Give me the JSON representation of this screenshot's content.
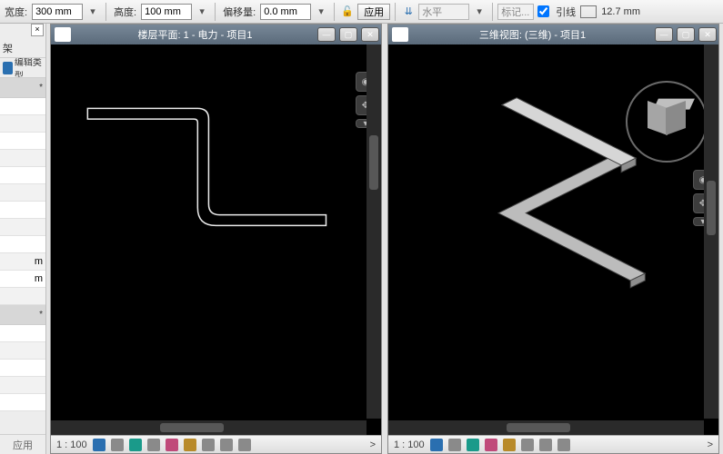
{
  "toolbar": {
    "width_label": "宽度:",
    "width_value": "300 mm",
    "height_label": "高度:",
    "height_value": "100 mm",
    "offset_label": "偏移量:",
    "offset_value": "0.0 mm",
    "apply_label": "应用",
    "alignment": "水平",
    "tag_label": "标记...",
    "leader_label": "引线",
    "leader_dim": "12.7 mm"
  },
  "sidebar": {
    "header_spacer": "",
    "row_tray": "架",
    "row_edit_type": "编辑类型",
    "unit_suffix": "m",
    "apply_label": "应用"
  },
  "views": {
    "left": {
      "title": "楼层平面: 1 - 电力 - 项目1",
      "scale": "1 : 100"
    },
    "right": {
      "title": "三维视图: (三维) - 项目1",
      "scale": "1 : 100"
    }
  }
}
